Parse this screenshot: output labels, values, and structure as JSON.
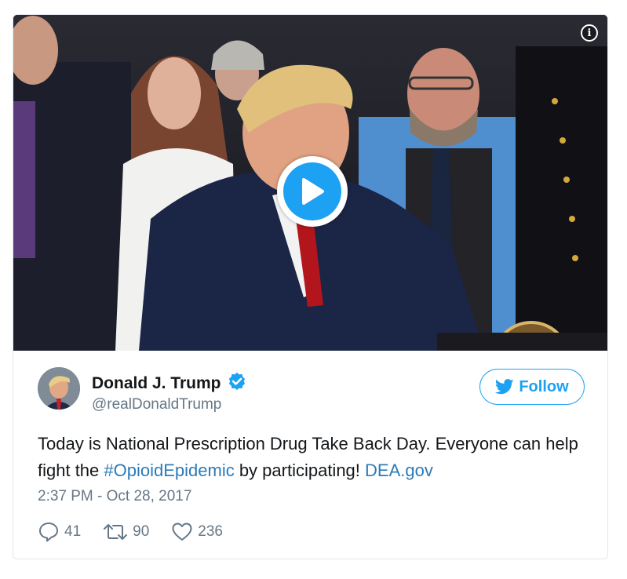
{
  "media": {
    "type": "video",
    "play_icon": "play-icon",
    "info_icon": "info-icon",
    "info_glyph": "i"
  },
  "author": {
    "display_name": "Donald J. Trump",
    "handle": "@realDonaldTrump",
    "verified_icon": "verified-badge-icon",
    "avatar_icon": "avatar"
  },
  "follow": {
    "label": "Follow",
    "icon": "twitter-bird-icon"
  },
  "tweet": {
    "text_part1": "Today is National Prescription Drug Take Back Day. Everyone can help fight the ",
    "hashtag": "#OpioidEpidemic",
    "text_part2": " by participating! ",
    "link": "DEA.gov"
  },
  "timestamp": "2:37 PM - Oct 28, 2017",
  "actions": {
    "replies": "41",
    "retweets": "90",
    "likes": "236"
  },
  "colors": {
    "accent": "#1da1f2",
    "link": "#2b7bb9",
    "text": "#14171a",
    "muted": "#657786",
    "border": "#e1e8ed"
  }
}
